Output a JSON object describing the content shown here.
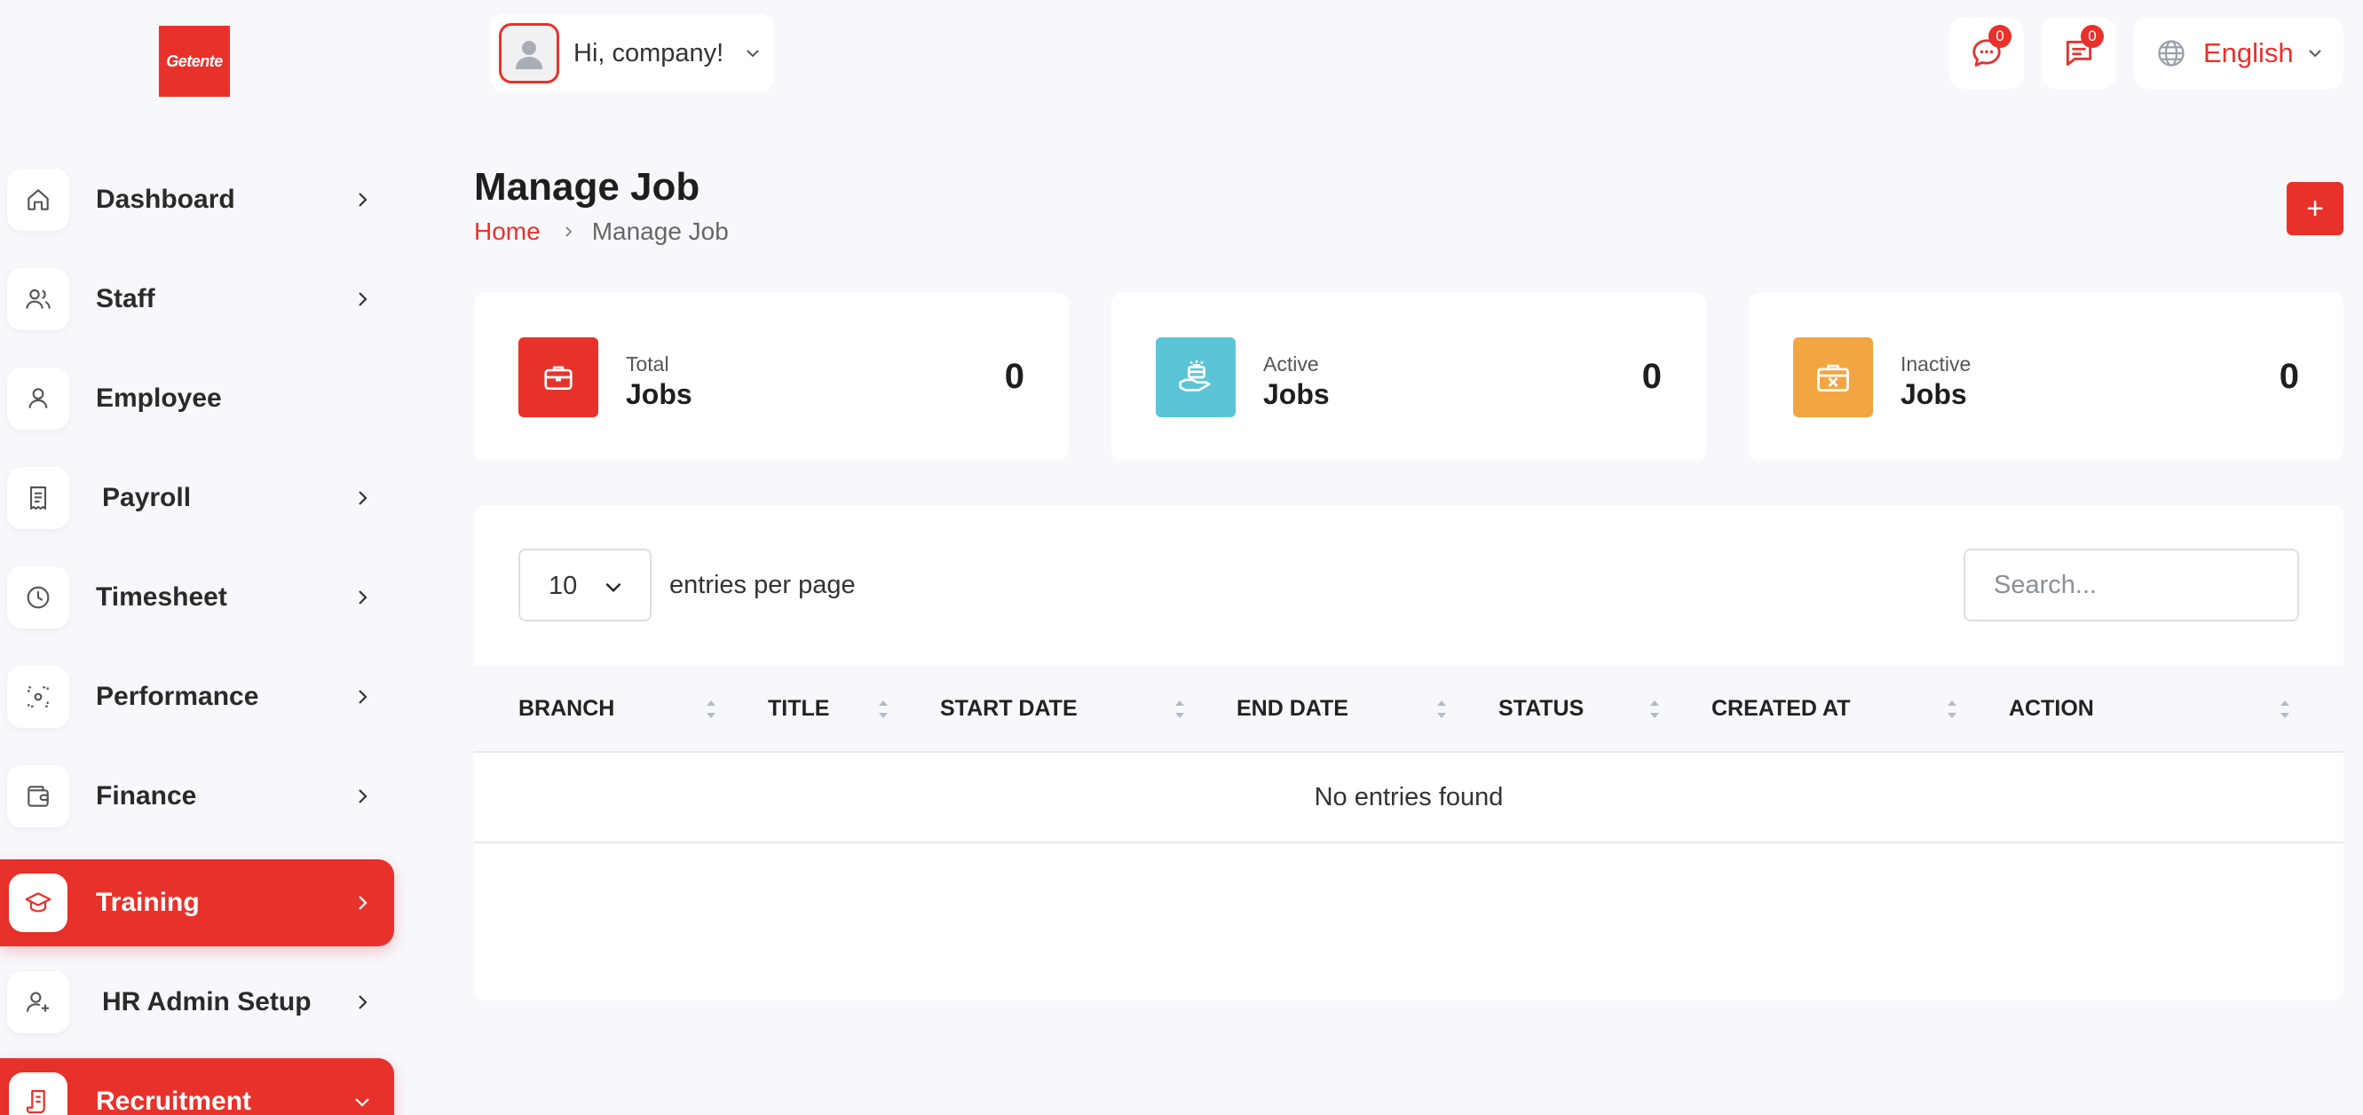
{
  "brand": {
    "logo_text": "Getente"
  },
  "sidebar": {
    "items": [
      {
        "label": "Dashboard",
        "icon": "home-icon",
        "has_chevron": true,
        "active": false
      },
      {
        "label": "Staff",
        "icon": "users-icon",
        "has_chevron": true,
        "active": false
      },
      {
        "label": "Employee",
        "icon": "user-icon",
        "has_chevron": false,
        "active": false
      },
      {
        "label": "Payroll",
        "icon": "receipt-icon",
        "has_chevron": true,
        "active": false
      },
      {
        "label": "Timesheet",
        "icon": "clock-icon",
        "has_chevron": true,
        "active": false
      },
      {
        "label": "Performance",
        "icon": "target-icon",
        "has_chevron": true,
        "active": false
      },
      {
        "label": "Finance",
        "icon": "wallet-icon",
        "has_chevron": true,
        "active": false
      },
      {
        "label": "Training",
        "icon": "graduation-cap-icon",
        "has_chevron": true,
        "active": true
      },
      {
        "label": "HR Admin Setup",
        "icon": "user-plus-icon",
        "has_chevron": true,
        "active": false
      },
      {
        "label": "Recruitment",
        "icon": "document-icon",
        "has_chevron": true,
        "active": true
      }
    ]
  },
  "header": {
    "greeting": "Hi, company!",
    "messages_badge": "0",
    "notifications_badge": "0",
    "language": "English"
  },
  "page": {
    "title": "Manage Job",
    "breadcrumb_home": "Home",
    "breadcrumb_current": "Manage Job",
    "add_button": "+"
  },
  "stats": [
    {
      "small": "Total",
      "big": "Jobs",
      "value": "0",
      "color": "#e9312b",
      "icon": "briefcase-icon"
    },
    {
      "small": "Active",
      "big": "Jobs",
      "value": "0",
      "color": "#5bc4d6",
      "icon": "hand-box-icon"
    },
    {
      "small": "Inactive",
      "big": "Jobs",
      "value": "0",
      "color": "#f2a541",
      "icon": "briefcase-x-icon"
    }
  ],
  "table": {
    "per_page": "10",
    "entries_label": "entries per page",
    "search_placeholder": "Search...",
    "columns": [
      "BRANCH",
      "TITLE",
      "START DATE",
      "END DATE",
      "STATUS",
      "CREATED AT",
      "ACTION"
    ],
    "empty_text": "No entries found"
  },
  "colors": {
    "accent": "#e9312b",
    "background": "#f7f8fc"
  }
}
